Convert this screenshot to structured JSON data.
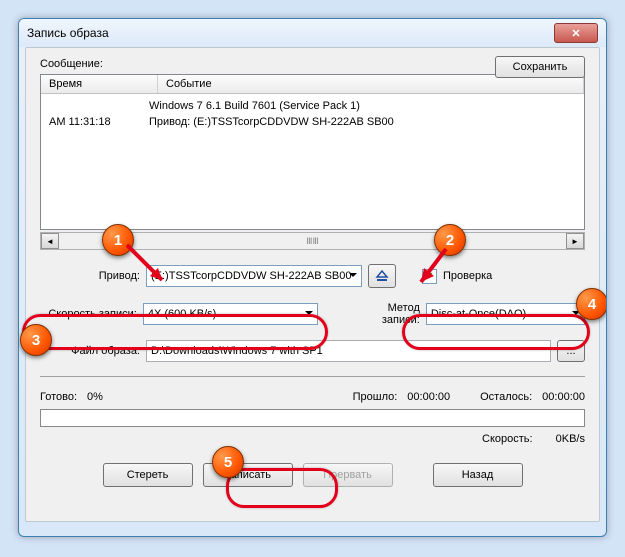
{
  "window": {
    "title": "Запись образа"
  },
  "messageLabel": "Сообщение:",
  "saveBtn": "Сохранить",
  "cols": {
    "time": "Время",
    "event": "Событие"
  },
  "log": {
    "time": "AM 11:31:18",
    "lines": [
      "Windows 7 6.1 Build 7601 (Service Pack 1)",
      "Привод: (E:)TSSTcorpCDDVDW SH-222AB SB00"
    ]
  },
  "drive": {
    "label": "Привод:",
    "value": "(E:)TSSTcorpCDDVDW SH-222AB SB00"
  },
  "verify": {
    "label": "Проверка",
    "checked": true
  },
  "speed": {
    "label": "Скорость записи:",
    "value": "4X (600 KB/s)"
  },
  "method": {
    "label": "Метод записи:",
    "value": "Disc-at-Once(DAO)"
  },
  "image": {
    "label": "Файл образа:",
    "value": "D:\\Downloads\\Windows 7 with SP1"
  },
  "status": {
    "ready": "Готово:",
    "pct": "0%",
    "elapsed": "Прошло:",
    "elapsedV": "00:00:00",
    "remain": "Осталось:",
    "remainV": "00:00:00",
    "speed": "Скорость:",
    "speedV": "0KB/s"
  },
  "btns": {
    "erase": "Стереть",
    "write": "Записать",
    "abort": "Прервать",
    "back": "Назад"
  },
  "scrollHint": "ⅢⅢ"
}
